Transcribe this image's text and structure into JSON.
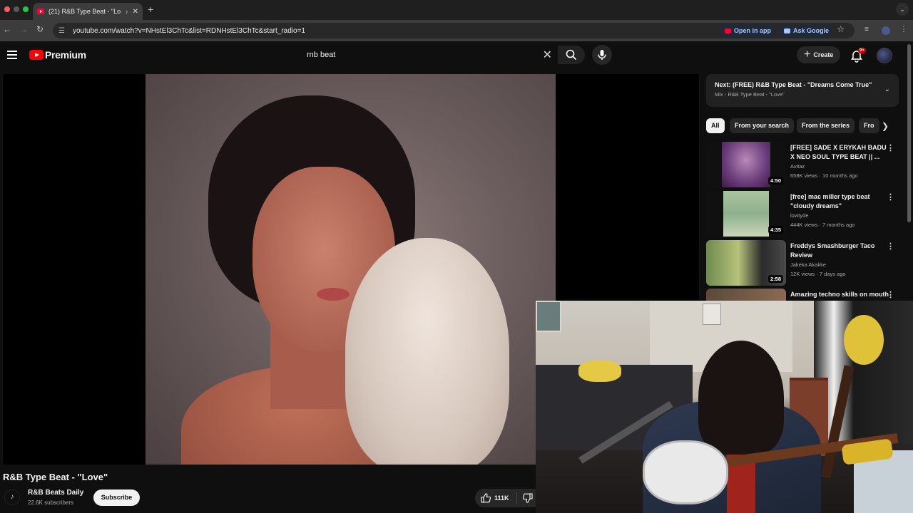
{
  "browser": {
    "tab_title": "(21) R&B Type Beat - \"Lo",
    "url": "youtube.com/watch?v=NHstEl3ChTc&list=RDNHstEl3ChTc&start_radio=1",
    "open_in_app": "Open in app",
    "ask_google": "Ask Google"
  },
  "masthead": {
    "brand": "Premium",
    "search_value": "rnb beat",
    "create_label": "Create",
    "notif_badge": "9+"
  },
  "video": {
    "title": "R&B Type Beat - \"Love\"",
    "channel": "R&B Beats Daily",
    "subscribers": "22.6K subscribers",
    "subscribe_label": "Subscribe",
    "likes": "111K"
  },
  "sidebar": {
    "next_title": "Next: (FREE) R&B Type Beat - \"Dreams Come True\"",
    "next_sub": "Mix - R&B Type Beat - \"Love\"",
    "chips": [
      "All",
      "From your search",
      "From the series",
      "Fro"
    ],
    "recommendations": [
      {
        "title": "[FREE] SADE X ERYKAH BADU X NEO SOUL TYPE BEAT || ...",
        "channel": "Avitaz",
        "meta": "658K views · 10 months ago",
        "duration": "4:50"
      },
      {
        "title": "[free] mac miller type beat \"cloudy dreams\"",
        "channel": "lowtyde",
        "meta": "444K views · 7 months ago",
        "duration": "4:35"
      },
      {
        "title": "Freddys Smashburger Taco Review",
        "channel": "Jakeka Akakke",
        "meta": "12K views · 7 days ago",
        "duration": "2:58"
      },
      {
        "title": "Amazing techno skills on mouth",
        "channel": "",
        "meta": "",
        "duration": ""
      }
    ]
  },
  "colors": {
    "yt_red": "#ff0000",
    "background": "#0f0f0f",
    "chip_active": "#f1f1f1"
  }
}
